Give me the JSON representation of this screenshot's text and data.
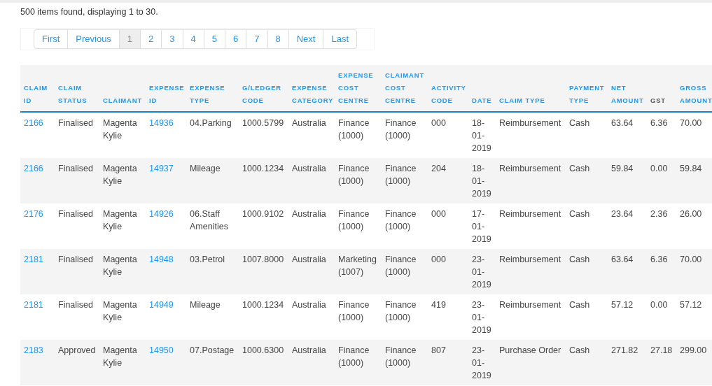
{
  "summary": "500 items found, displaying 1 to 30.",
  "pagination": [
    {
      "label": "First",
      "selected": false
    },
    {
      "label": "Previous",
      "selected": false
    },
    {
      "label": "1",
      "selected": true
    },
    {
      "label": "2",
      "selected": false
    },
    {
      "label": "3",
      "selected": false
    },
    {
      "label": "4",
      "selected": false
    },
    {
      "label": "5",
      "selected": false
    },
    {
      "label": "6",
      "selected": false
    },
    {
      "label": "7",
      "selected": false
    },
    {
      "label": "8",
      "selected": false
    },
    {
      "label": "Next",
      "selected": false
    },
    {
      "label": "Last",
      "selected": false
    }
  ],
  "table": {
    "columns": [
      {
        "label": "CLAIM ID",
        "sortable": true,
        "kind": "link"
      },
      {
        "label": "CLAIM STATUS",
        "sortable": true
      },
      {
        "label": "CLAIMANT",
        "sortable": true
      },
      {
        "label": "EXPENSE ID",
        "sortable": true,
        "kind": "link"
      },
      {
        "label": "EXPENSE TYPE",
        "sortable": true
      },
      {
        "label": "G/LEDGER CODE",
        "sortable": true
      },
      {
        "label": "EXPENSE CATEGORY",
        "sortable": true
      },
      {
        "label": "EXPENSE COST CENTRE",
        "sortable": true
      },
      {
        "label": "CLAIMANT COST CENTRE",
        "sortable": true
      },
      {
        "label": "ACTIVITY CODE",
        "sortable": true
      },
      {
        "label": "DATE",
        "sortable": true
      },
      {
        "label": "CLAIM TYPE",
        "sortable": true
      },
      {
        "label": "PAYMENT TYPE",
        "sortable": true
      },
      {
        "label": "NET AMOUNT",
        "sortable": true
      },
      {
        "label": "GST",
        "sortable": false
      },
      {
        "label": "GROSS AMOUNT",
        "sortable": true
      }
    ],
    "rows": [
      [
        "2166",
        "Finalised",
        "Magenta Kylie",
        "14936",
        "04.Parking",
        "1000.5799",
        "Australia",
        "Finance (1000)",
        "Finance (1000)",
        "000",
        "18-01-2019",
        "Reimbursement",
        "Cash",
        "63.64",
        "6.36",
        "70.00"
      ],
      [
        "2166",
        "Finalised",
        "Magenta Kylie",
        "14937",
        "Mileage",
        "1000.1234",
        "Australia",
        "Finance (1000)",
        "Finance (1000)",
        "204",
        "18-01-2019",
        "Reimbursement",
        "Cash",
        "59.84",
        "0.00",
        "59.84"
      ],
      [
        "2176",
        "Finalised",
        "Magenta Kylie",
        "14926",
        "06.Staff Amenities",
        "1000.9102",
        "Australia",
        "Finance (1000)",
        "Finance (1000)",
        "000",
        "17-01-2019",
        "Reimbursement",
        "Cash",
        "23.64",
        "2.36",
        "26.00"
      ],
      [
        "2181",
        "Finalised",
        "Magenta Kylie",
        "14948",
        "03.Petrol",
        "1007.8000",
        "Australia",
        "Marketing (1007)",
        "Finance (1000)",
        "000",
        "23-01-2019",
        "Reimbursement",
        "Cash",
        "63.64",
        "6.36",
        "70.00"
      ],
      [
        "2181",
        "Finalised",
        "Magenta Kylie",
        "14949",
        "Mileage",
        "1000.1234",
        "Australia",
        "Finance (1000)",
        "Finance (1000)",
        "419",
        "23-01-2019",
        "Reimbursement",
        "Cash",
        "57.12",
        "0.00",
        "57.12"
      ],
      [
        "2183",
        "Approved",
        "Magenta Kylie",
        "14950",
        "07.Postage",
        "1000.6300",
        "Australia",
        "Finance (1000)",
        "Finance (1000)",
        "807",
        "23-01-2019",
        "Purchase Order",
        "Cash",
        "271.82",
        "27.18",
        "299.00"
      ]
    ]
  }
}
